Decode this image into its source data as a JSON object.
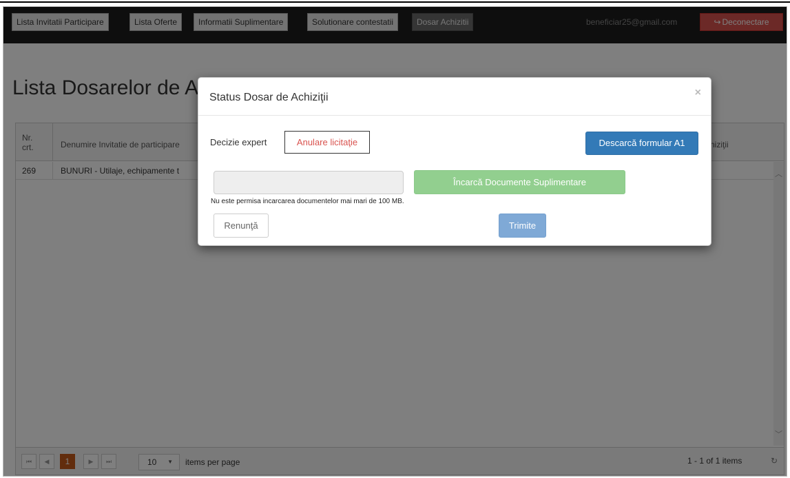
{
  "navbar": {
    "items": [
      {
        "label": "Lista Invitatii Participare"
      },
      {
        "label": "Lista Oferte"
      },
      {
        "label": "Informatii Suplimentare"
      },
      {
        "label": "Solutionare contestatii"
      },
      {
        "label": "Dosar Achizitii"
      }
    ],
    "active_item": "Dosar Achizitii",
    "user_email": "beneficiar25@gmail.com",
    "logout_label": "Deconectare",
    "logout_icon": "sign-out-icon"
  },
  "page": {
    "title": "Lista Dosarelor de A"
  },
  "grid": {
    "columns": [
      {
        "label": "Nr.\ncrt."
      },
      {
        "label": "Denumire Invitatie de participare"
      },
      {
        "label": "hiziţii"
      }
    ],
    "rows": [
      {
        "nr": "269",
        "denumire": "BUNURI - Utilaje, echipamente t"
      }
    ],
    "pager": {
      "current_page": "1",
      "page_size": "10",
      "page_size_label": "items per page",
      "info": "1 - 1 of 1 items"
    }
  },
  "modal": {
    "title": "Status Dosar de Achiziţii",
    "close_symbol": "×",
    "decizie_label": "Decizie expert",
    "anulare_label": "Anulare licitaţie",
    "descarca_label": "Descarcă formular A1",
    "incarca_label": "Încarcă Documente Suplimentare",
    "note": "Nu este permisa incarcarea documentelor mai mari de 100 MB.",
    "renunta_label": "Renunţă",
    "trimite_label": "Trimite"
  },
  "colors": {
    "navbar_bg": "#1c1c1c",
    "danger": "#d9534f",
    "primary": "#337ab7",
    "success_disabled": "#92cf8f",
    "pager_current": "#c45b1a"
  }
}
